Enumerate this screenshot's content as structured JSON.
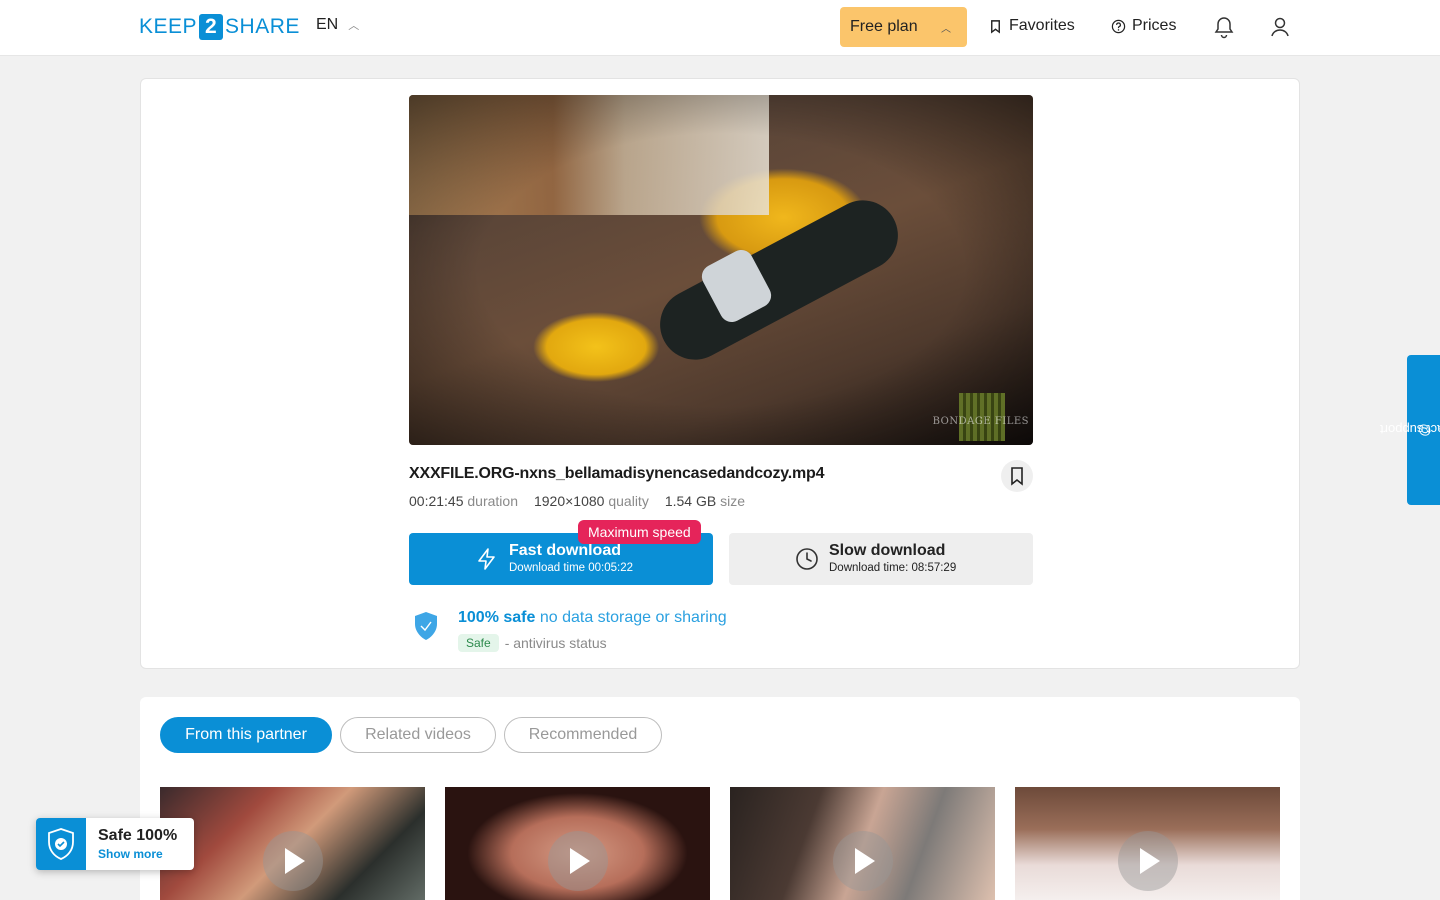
{
  "header": {
    "logo": {
      "left": "KEEP",
      "mid": "2",
      "right": "SHARE"
    },
    "language": "EN",
    "plan_label": "Free plan",
    "favorites_label": "Favorites",
    "prices_label": "Prices"
  },
  "file": {
    "name": "XXXFILE.ORG-nxns_bellamadisynencasedandcozy.mp4",
    "duration": "00:21:45",
    "duration_label": "duration",
    "quality": "1920×1080",
    "quality_label": "quality",
    "size": "1.54 GB",
    "size_label": "size",
    "watermark": "BONDAGE FILES"
  },
  "download": {
    "fast_title": "Fast download",
    "fast_time": "Download time 00:05:22",
    "max_speed_badge": "Maximum speed",
    "slow_title": "Slow download",
    "slow_time": "Download time: 08:57:29"
  },
  "safety": {
    "title_bold": "100% safe",
    "title_rest": "no data storage or sharing",
    "badge": "Safe",
    "antivirus_text": "- antivirus status"
  },
  "support_label": "contact support",
  "tabs": [
    {
      "label": "From this partner",
      "active": true
    },
    {
      "label": "Related videos",
      "active": false
    },
    {
      "label": "Recommended",
      "active": false
    }
  ],
  "safe_float": {
    "title": "Safe 100%",
    "link": "Show more"
  },
  "colors": {
    "accent": "#0a8fd6",
    "plan": "#fbc56b",
    "badge_red": "#e5245a"
  }
}
